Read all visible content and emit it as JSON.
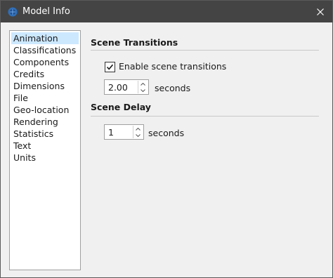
{
  "window": {
    "title": "Model Info"
  },
  "sidebar": {
    "items": [
      {
        "label": "Animation",
        "selected": true
      },
      {
        "label": "Classifications"
      },
      {
        "label": "Components"
      },
      {
        "label": "Credits"
      },
      {
        "label": "Dimensions"
      },
      {
        "label": "File"
      },
      {
        "label": "Geo-location"
      },
      {
        "label": "Rendering"
      },
      {
        "label": "Statistics"
      },
      {
        "label": "Text"
      },
      {
        "label": "Units"
      }
    ]
  },
  "scene_transitions": {
    "heading": "Scene Transitions",
    "checkbox_label": "Enable scene transitions",
    "checked": true,
    "value": "2.00",
    "unit": "seconds"
  },
  "scene_delay": {
    "heading": "Scene Delay",
    "value": "1",
    "unit": "seconds"
  },
  "colors": {
    "titlebar": "#444444",
    "selection": "#cce8ff"
  }
}
